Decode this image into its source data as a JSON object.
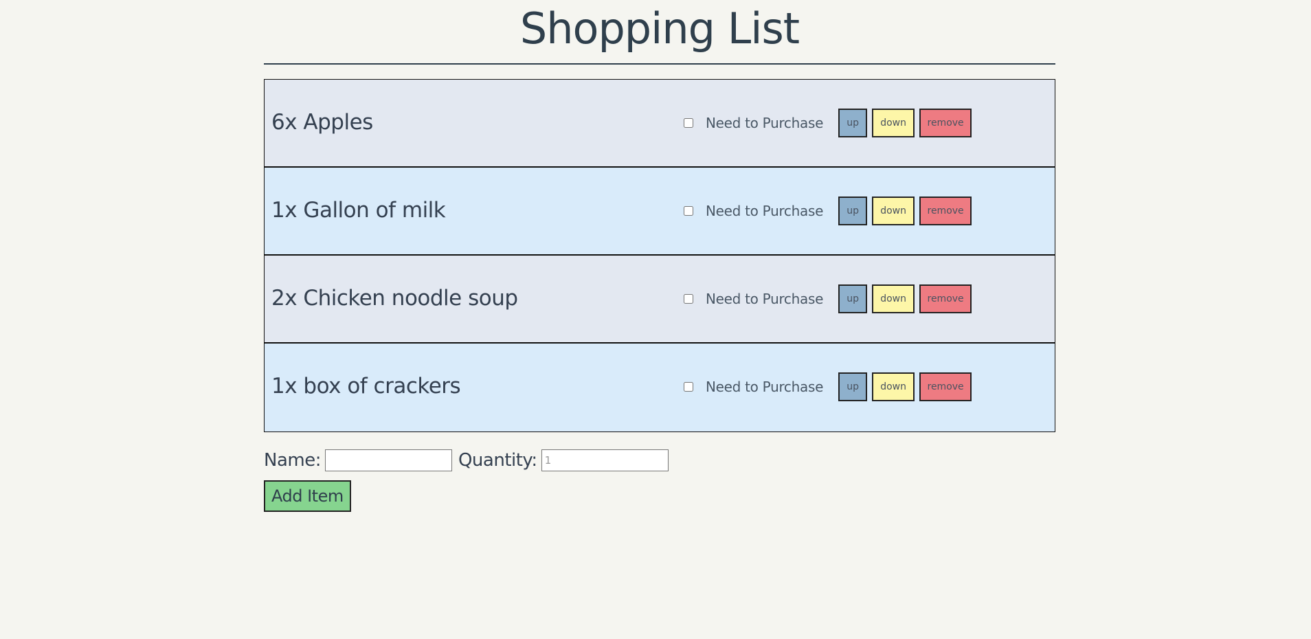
{
  "page": {
    "title": "Shopping List"
  },
  "items": [
    {
      "text": "6x Apples",
      "need_label": "Need to Purchase",
      "checked": false,
      "up_label": "up",
      "down_label": "down",
      "remove_label": "remove"
    },
    {
      "text": "1x Gallon of milk",
      "need_label": "Need to Purchase",
      "checked": false,
      "up_label": "up",
      "down_label": "down",
      "remove_label": "remove"
    },
    {
      "text": "2x Chicken noodle soup",
      "need_label": "Need to Purchase",
      "checked": false,
      "up_label": "up",
      "down_label": "down",
      "remove_label": "remove"
    },
    {
      "text": "1x box of crackers",
      "need_label": "Need to Purchase",
      "checked": false,
      "up_label": "up",
      "down_label": "down",
      "remove_label": "remove"
    }
  ],
  "form": {
    "name_label": "Name:",
    "name_value": "",
    "quantity_label": "Quantity:",
    "quantity_placeholder": "1",
    "quantity_value": "",
    "add_label": "Add Item"
  },
  "colors": {
    "background": "#f5f5f0",
    "row_odd": "#e3e8f1",
    "row_even": "#d9ebfa",
    "up_button": "#8eb0cc",
    "down_button": "#fdf6a8",
    "remove_button": "#ee7b82",
    "add_button": "#86d48f",
    "text": "#344050"
  }
}
